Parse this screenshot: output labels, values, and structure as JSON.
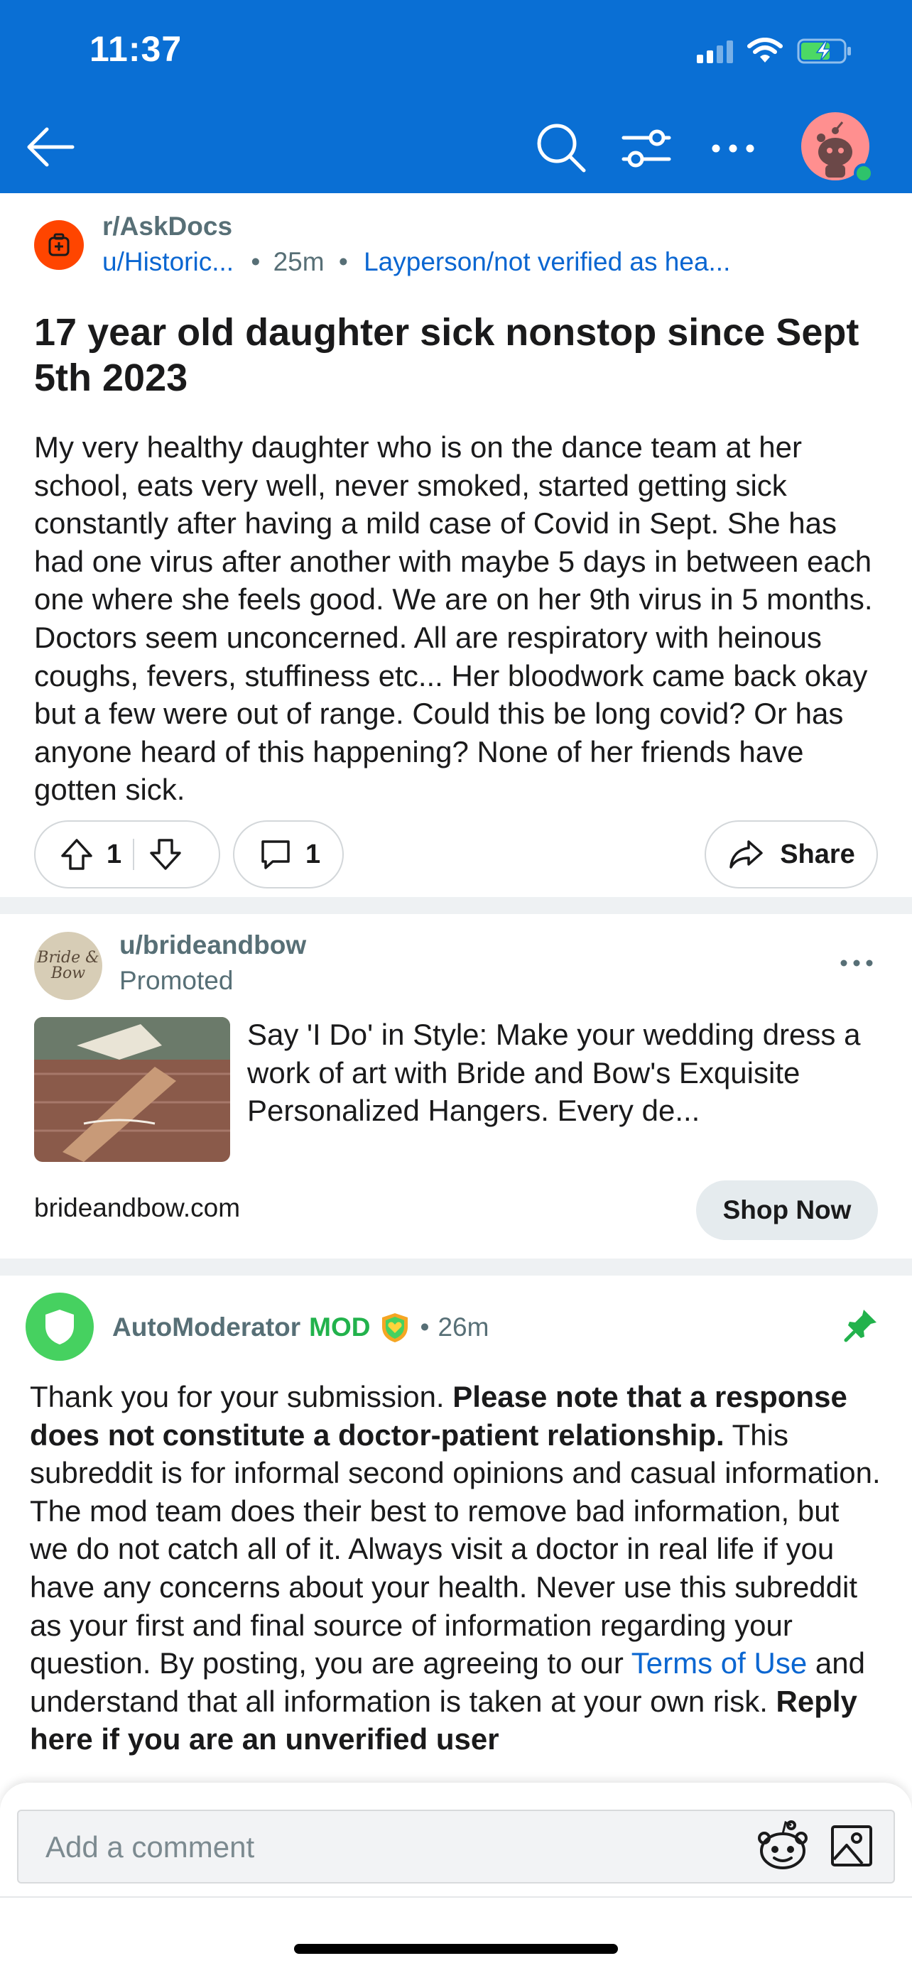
{
  "status_bar": {
    "time": "11:37",
    "icons": [
      "cellular-signal-icon",
      "wifi-icon",
      "battery-charging-icon"
    ]
  },
  "top_nav": {
    "icons": [
      "back-arrow-icon",
      "search-icon",
      "filter-icon",
      "more-icon",
      "avatar"
    ]
  },
  "post": {
    "subreddit": "r/AskDocs",
    "author": "u/Historic...",
    "separator1": "•",
    "age": "25m",
    "separator2": "•",
    "flair": "Layperson/not verified as hea...",
    "title": "17 year old daughter sick nonstop since Sept 5th 2023",
    "body": "My very healthy daughter who is on the dance team at her school, eats very well, never smoked, started getting sick constantly after having a mild case of Covid in Sept. She has had one virus after another with maybe 5 days in between each one where she feels good. We are on her 9th virus in 5 months. Doctors seem unconcerned. All are respiratory with heinous coughs, fevers, stuffiness etc... Her bloodwork came back okay but a few were out of range. Could this be long covid? Or has anyone heard of this happening? None of her friends have gotten sick.",
    "vote_count": "1",
    "comment_count": "1",
    "share_label": "Share"
  },
  "ad": {
    "avatar_text": "Bride & Bow",
    "user": "u/brideandbow",
    "promoted_label": "Promoted",
    "text": "Say 'I Do' in Style: Make your wedding dress a work of art with Bride and Bow's Exquisite Personalized Hangers. Every de...",
    "domain": "brideandbow.com",
    "cta_label": "Shop Now"
  },
  "comment": {
    "author": "AutoModerator",
    "badge": "MOD",
    "separator": "•",
    "age": "26m",
    "body_1": "Thank you for your submission. ",
    "body_bold_1": "Please note that a response does not constitute a doctor-patient relationship.",
    "body_2": " This subreddit is for informal second opinions and casual information. The mod team does their best to remove bad information, but we do not catch all of it. Always visit a doctor in real life if you have any concerns about your health. Never use this subreddit as your first and final source of information regarding your question. By posting, you are agreeing to our ",
    "body_link": "Terms of Use",
    "body_3": " and understand that all information is taken at your own risk. ",
    "body_bold_2": "Reply here if you are an unverified user"
  },
  "comment_bar": {
    "placeholder": "Add a comment"
  },
  "colors": {
    "header": "#0a6fd4",
    "link": "#0a66d1",
    "mod_green": "#22b24c",
    "subreddit_icon": "#ff4500"
  }
}
